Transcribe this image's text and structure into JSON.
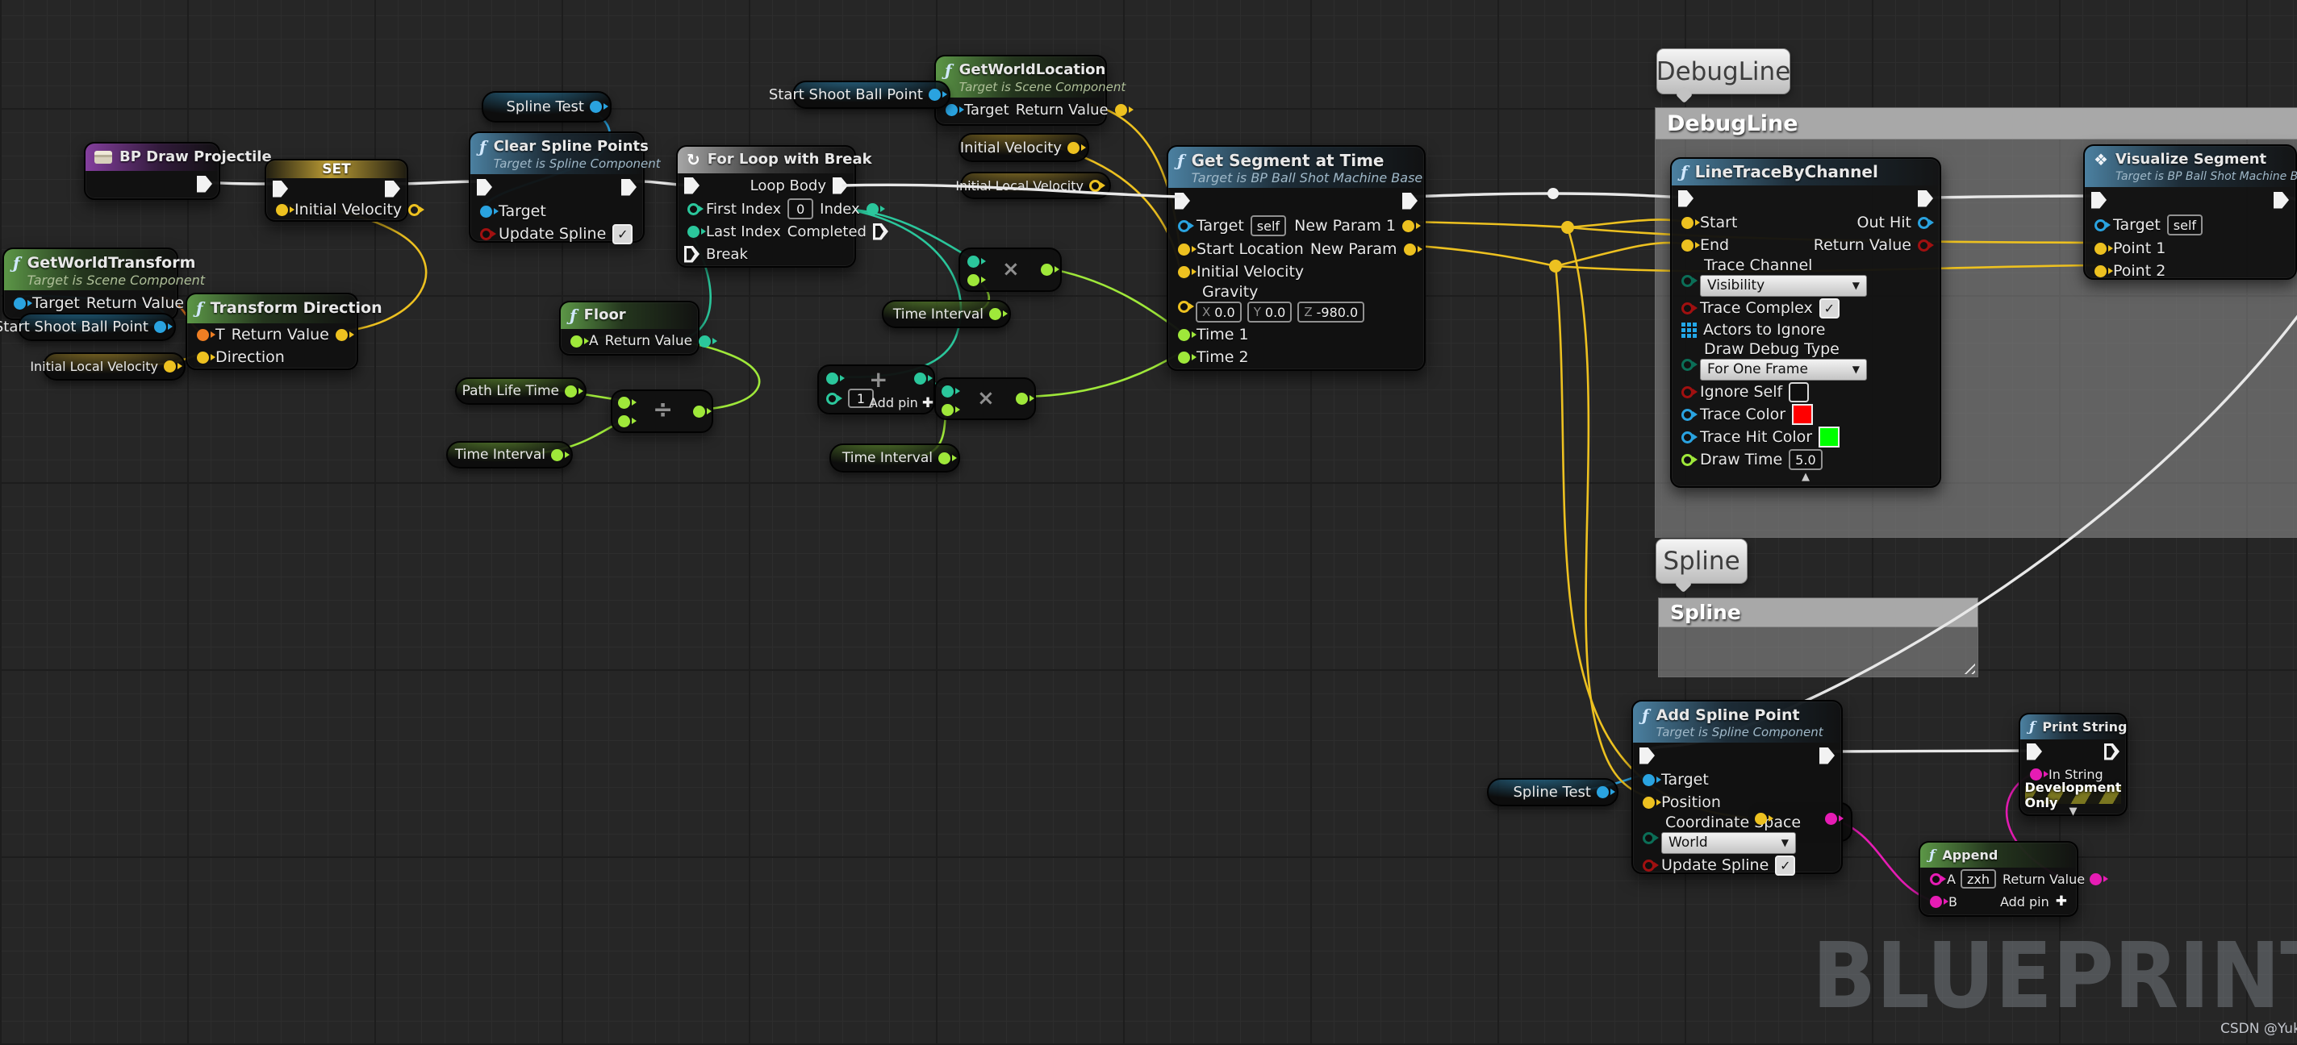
{
  "canvas": {
    "watermark": "BLUEPRINT",
    "credit": "CSDN @Yuk`"
  },
  "tooltips": {
    "debugline": "DebugLine",
    "spline": "Spline"
  },
  "comments": {
    "debugline": "DebugLine",
    "spline": "Spline"
  },
  "icons": {
    "function": "ƒ",
    "macro": "↻",
    "event_diamond": "❖",
    "collapse_up": "▲",
    "collapse_down": "▼",
    "dropdown_arrow": "▼",
    "add": "✚",
    "check": "✓"
  },
  "ops": {
    "multiply": "×",
    "divide": "÷",
    "add": "+",
    "add_pin_label": "Add pin",
    "add_default_value": "1"
  },
  "vars": {
    "start_shoot_ball_point": "Start Shoot Ball Point",
    "initial_local_velocity": "Initial Local Velocity",
    "initial_velocity": "Initial Velocity",
    "spline_test": "Spline Test",
    "path_life_time": "Path Life Time",
    "time_interval": "Time Interval"
  },
  "colors": {
    "exec": "#e8e8e8",
    "vector": "#edc120",
    "float": "#9fe83a",
    "int": "#2bc79c",
    "object": "#2aa3e0",
    "bool": "#a01010",
    "enum": "#0b6e57",
    "string": "#e61cb4",
    "transform": "#ee7e23",
    "trace_color": "#ff0000",
    "trace_hit_color": "#00ff00"
  },
  "nodes": {
    "bp_draw_projectile": {
      "title": "BP Draw Projectile"
    },
    "set": {
      "title": "SET",
      "initial_velocity": "Initial Velocity"
    },
    "get_world_transform": {
      "title": "GetWorldTransform",
      "subtitle": "Target is Scene Component",
      "target": "Target",
      "return_value": "Return Value"
    },
    "transform_direction": {
      "title": "Transform Direction",
      "t": "T",
      "direction": "Direction",
      "return_value": "Return Value"
    },
    "clear_spline_points": {
      "title": "Clear Spline Points",
      "subtitle": "Target is Spline Component",
      "target": "Target",
      "update_spline": "Update Spline"
    },
    "for_loop_with_break": {
      "title": "For Loop with Break",
      "first_index": "First Index",
      "first_index_value": "0",
      "last_index": "Last Index",
      "break_pin": "Break",
      "loop_body": "Loop Body",
      "index": "Index",
      "completed": "Completed"
    },
    "floor": {
      "title": "Floor",
      "a": "A",
      "return_value": "Return Value"
    },
    "get_world_location": {
      "title": "GetWorldLocation",
      "subtitle": "Target is Scene Component",
      "target": "Target",
      "return_value": "Return Value"
    },
    "get_segment_at_time": {
      "title": "Get Segment at Time",
      "subtitle": "Target is BP Ball Shot Machine Base",
      "target": "Target",
      "target_value": "self",
      "start_location": "Start Location",
      "initial_velocity": "Initial Velocity",
      "gravity": "Gravity",
      "gx_label": "X",
      "gx": "0.0",
      "gy_label": "Y",
      "gy": "0.0",
      "gz_label": "Z",
      "gz": "-980.0",
      "time1": "Time 1",
      "time2": "Time 2",
      "new_param_1": "New Param 1",
      "new_param": "New Param"
    },
    "line_trace": {
      "title": "LineTraceByChannel",
      "start": "Start",
      "end": "End",
      "trace_channel": "Trace Channel",
      "trace_channel_value": "Visibility",
      "trace_complex": "Trace Complex",
      "actors_to_ignore": "Actors to Ignore",
      "draw_debug_type": "Draw Debug Type",
      "draw_debug_type_value": "For One Frame",
      "ignore_self": "Ignore Self",
      "trace_color": "Trace Color",
      "trace_hit_color": "Trace Hit Color",
      "draw_time": "Draw Time",
      "draw_time_value": "5.0",
      "out_hit": "Out Hit",
      "return_value": "Return Value"
    },
    "visualize_segment": {
      "title": "Visualize Segment",
      "subtitle": "Target is BP Ball Shot Machine Base",
      "target": "Target",
      "target_value": "self",
      "point1": "Point 1",
      "point2": "Point 2"
    },
    "add_spline_point": {
      "title": "Add Spline Point",
      "subtitle": "Target is Spline Component",
      "target": "Target",
      "position": "Position",
      "coordinate_space": "Coordinate Space",
      "coordinate_space_value": "World",
      "update_spline": "Update Spline"
    },
    "print_string": {
      "title": "Print String",
      "in_string": "In String",
      "dev_only": "Development Only"
    },
    "append": {
      "title": "Append",
      "a": "A",
      "a_value": "zxh",
      "b": "B",
      "return_value": "Return Value",
      "add_pin_label": "Add pin"
    }
  }
}
